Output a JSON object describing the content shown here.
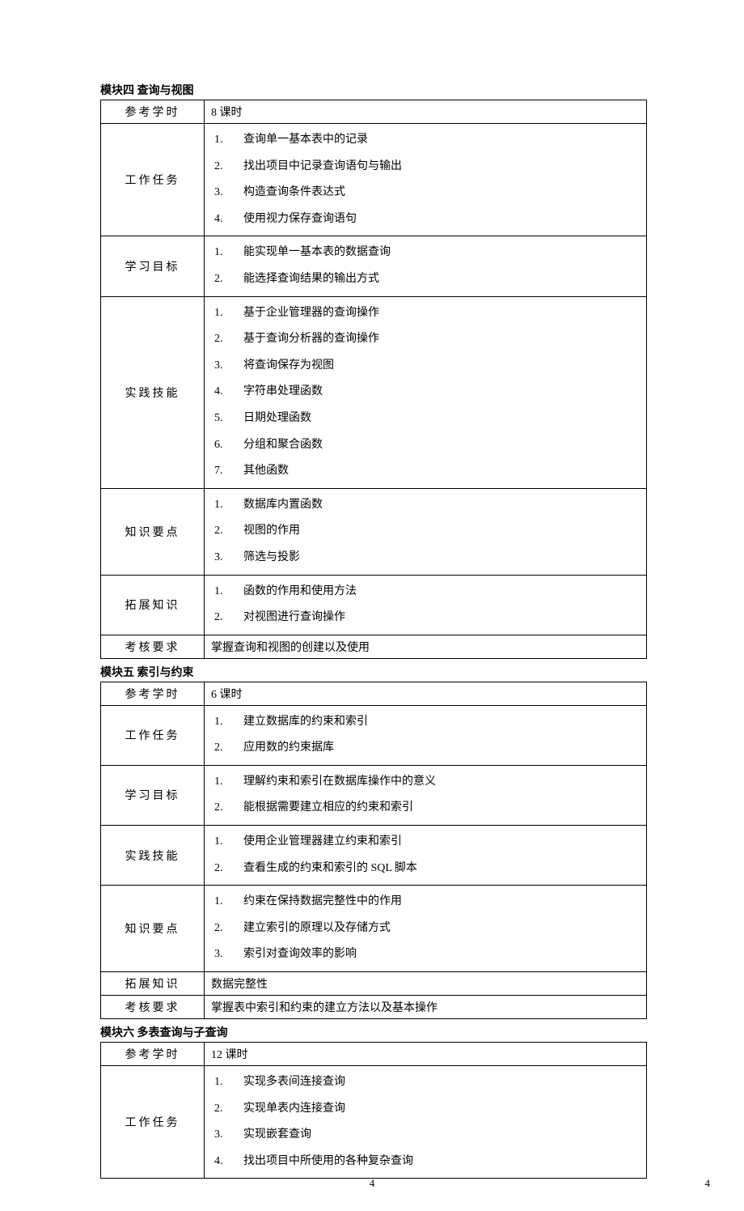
{
  "modules": [
    {
      "title": "模块四  查询与视图",
      "rows": [
        {
          "label": "参考学时",
          "type": "text",
          "text": "8 课时"
        },
        {
          "label": "工作任务",
          "type": "list",
          "items": [
            "查询单一基本表中的记录",
            "找出项目中记录查询语句与输出",
            "构造查询条件表达式",
            "使用视力保存查询语句"
          ]
        },
        {
          "label": "学习目标",
          "type": "list",
          "items": [
            "能实现单一基本表的数据查询",
            "能选择查询结果的输出方式"
          ]
        },
        {
          "label": "实践技能",
          "type": "list",
          "items": [
            "基于企业管理器的查询操作",
            "基于查询分析器的查询操作",
            "将查询保存为视图",
            "字符串处理函数",
            "日期处理函数",
            "分组和聚合函数",
            "其他函数"
          ]
        },
        {
          "label": "知识要点",
          "type": "list",
          "items": [
            "数据库内置函数",
            "视图的作用",
            "筛选与投影"
          ]
        },
        {
          "label": "拓展知识",
          "type": "list",
          "items": [
            "函数的作用和使用方法",
            "对视图进行查询操作"
          ]
        },
        {
          "label": "考核要求",
          "type": "text",
          "text": "掌握查询和视图的创建以及使用"
        }
      ]
    },
    {
      "title": "模块五  索引与约束",
      "rows": [
        {
          "label": "参考学时",
          "type": "text",
          "text": "6 课时"
        },
        {
          "label": "工作任务",
          "type": "list",
          "items": [
            "建立数据库的约束和索引",
            "应用数的约束据库"
          ]
        },
        {
          "label": "学习目标",
          "type": "list",
          "items": [
            "理解约束和索引在数据库操作中的意义",
            "能根据需要建立相应的约束和索引"
          ]
        },
        {
          "label": "实践技能",
          "type": "list",
          "items": [
            "使用企业管理器建立约束和索引",
            "查看生成的约束和索引的 SQL 脚本"
          ]
        },
        {
          "label": "知识要点",
          "type": "list",
          "items": [
            "约束在保持数据完整性中的作用",
            "建立索引的原理以及存储方式",
            "索引对查询效率的影响"
          ]
        },
        {
          "label": "拓展知识",
          "type": "text",
          "text": "数据完整性"
        },
        {
          "label": "考核要求",
          "type": "text",
          "text": "掌握表中索引和约束的建立方法以及基本操作"
        }
      ]
    },
    {
      "title": "模块六  多表查询与子查询",
      "rows": [
        {
          "label": "参考学时",
          "type": "text",
          "text": "12 课时"
        },
        {
          "label": "工作任务",
          "type": "list",
          "items": [
            "实现多表间连接查询",
            "实现单表内连接查询",
            "实现嵌套查询",
            "找出项目中所使用的各种复杂查询"
          ]
        }
      ]
    }
  ],
  "footer": {
    "center": "4",
    "right": "4"
  }
}
